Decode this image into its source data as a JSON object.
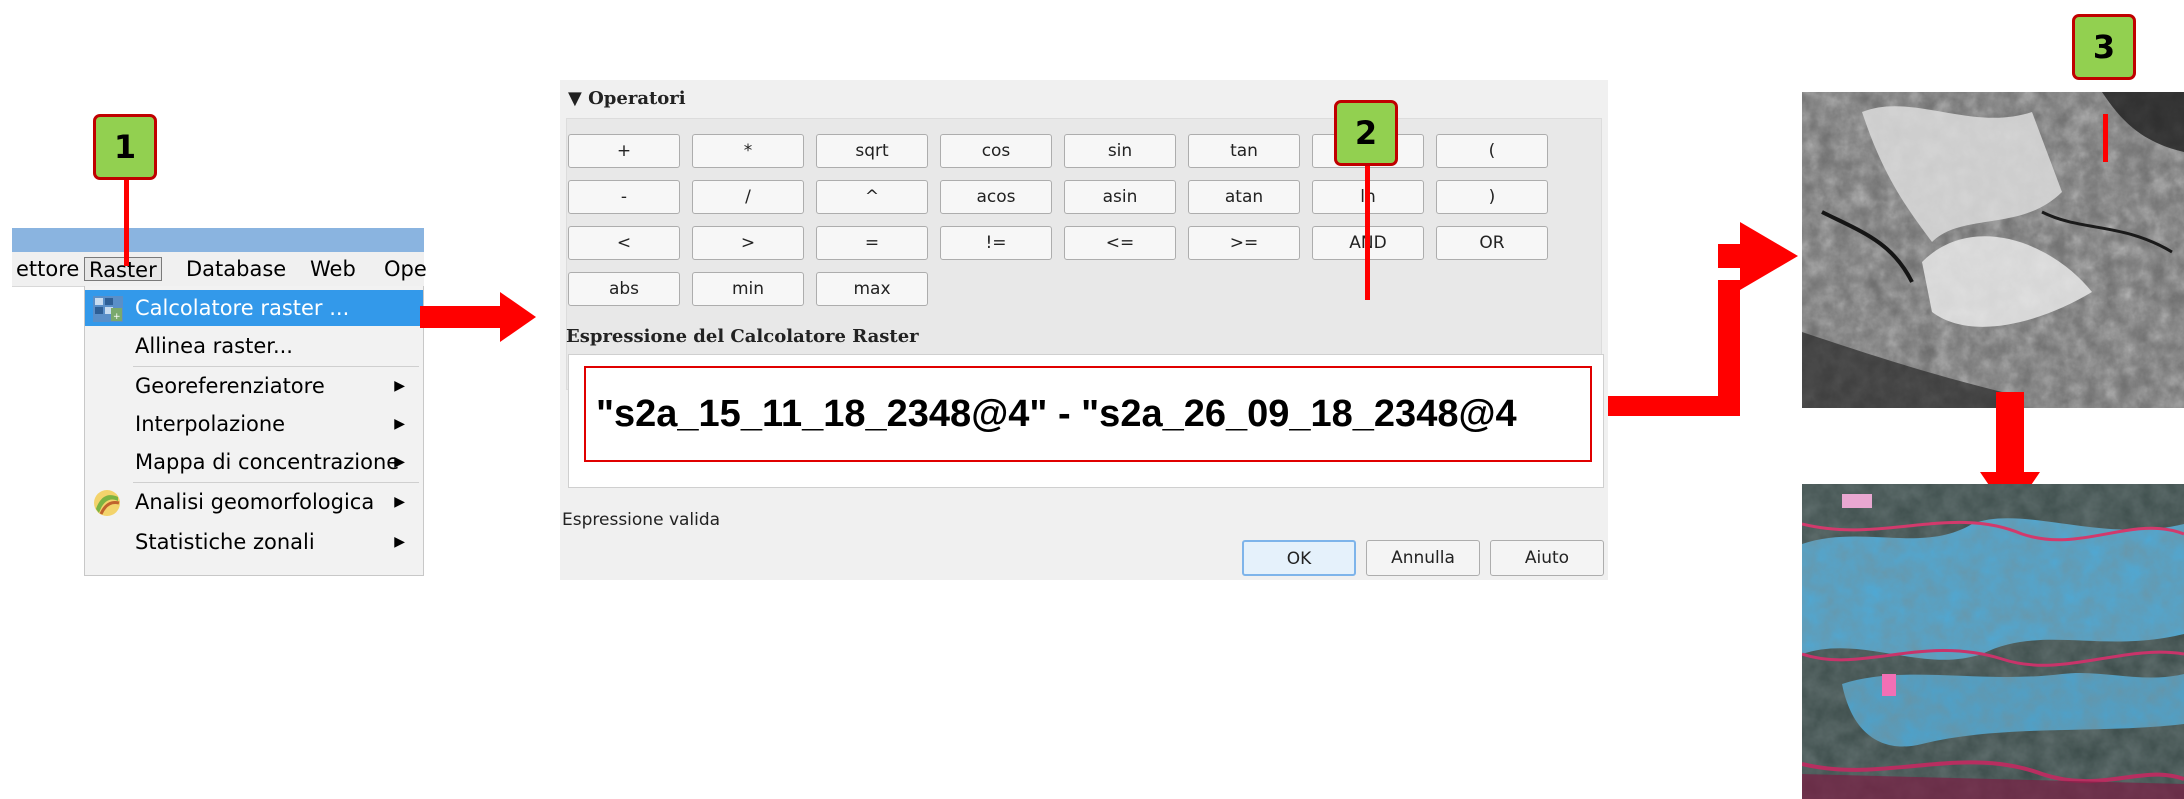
{
  "menu": {
    "menubar_items": [
      "ettore",
      "Raster",
      "Database",
      "Web",
      "Ope"
    ],
    "dropdown_items": [
      {
        "label": "Calcolatore raster ...",
        "icon": "raster-calculator-icon",
        "submenu": false,
        "selected": true
      },
      {
        "label": "Allinea raster...",
        "icon": "",
        "submenu": false,
        "selected": false
      },
      {
        "label": "Georeferenziatore",
        "icon": "",
        "submenu": true,
        "selected": false
      },
      {
        "label": "Interpolazione",
        "icon": "",
        "submenu": true,
        "selected": false
      },
      {
        "label": "Mappa di concentrazione",
        "icon": "",
        "submenu": true,
        "selected": false
      },
      {
        "label": "Analisi geomorfologica",
        "icon": "geomorphology-icon",
        "submenu": true,
        "selected": false
      },
      {
        "label": "Statistiche zonali",
        "icon": "",
        "submenu": true,
        "selected": false
      }
    ]
  },
  "callouts": [
    "1",
    "2",
    "3"
  ],
  "calculator": {
    "operators_title": "Operatori",
    "operators_rows": [
      [
        "+",
        "*",
        "sqrt",
        "cos",
        "sin",
        "tan",
        "",
        "("
      ],
      [
        "-",
        "/",
        "^",
        "acos",
        "asin",
        "atan",
        "ln",
        ")"
      ],
      [
        "<",
        ">",
        "=",
        "!=",
        "<=",
        ">=",
        "AND",
        "OR"
      ],
      [
        "abs",
        "min",
        "max"
      ]
    ],
    "expression_title": "Espressione del Calcolatore Raster",
    "expression": "\"s2a_15_11_18_2348@4\" - \"s2a_26_09_18_2348@4",
    "status": "Espressione valida",
    "buttons": {
      "ok": "OK",
      "cancel": "Annulla",
      "help": "Aiuto"
    }
  },
  "colors": {
    "accent_red": "#ff0000",
    "callout_fill": "#92d050",
    "callout_border": "#c00000",
    "menu_selection": "#3399ea"
  }
}
